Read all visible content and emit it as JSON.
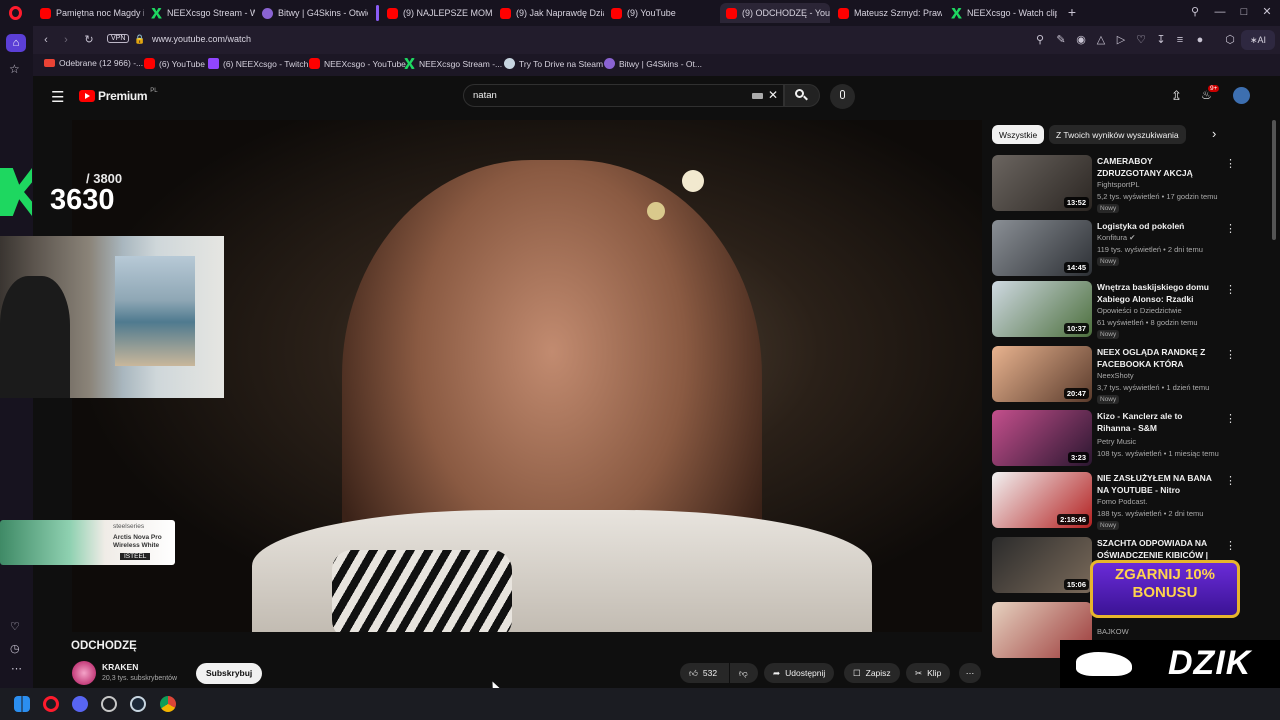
{
  "tabs": [
    {
      "label": "Pamiętna noc Magdy i St",
      "icon": "youtube-icon"
    },
    {
      "label": "NEEXcsgo Stream - Watch",
      "icon": "neex-icon"
    },
    {
      "label": "Bitwy | G4Skins - Otwieraj",
      "icon": "g4skins-icon"
    },
    {
      "label": "(9) NAJLEPSZE MOMENTY",
      "icon": "youtube-icon"
    },
    {
      "label": "(9) Jak Naprawdę Działa F",
      "icon": "youtube-icon"
    },
    {
      "label": "(9) YouTube",
      "icon": "youtube-icon"
    },
    {
      "label": "(9) ODCHODZĘ - You",
      "icon": "youtube-icon"
    },
    {
      "label": "Mateusz Szmyd: Prawie zg",
      "icon": "youtube-icon"
    },
    {
      "label": "NEEXcsgo - Watch clips o",
      "icon": "neex-icon"
    }
  ],
  "address": {
    "vpn": "VPN",
    "url": "www.youtube.com/watch",
    "ai": "AI"
  },
  "bookmarks": [
    {
      "label": "Odebrane (12 966) -..."
    },
    {
      "label": "(6) YouTube"
    },
    {
      "label": "(6) NEEXcsgo - Twitch"
    },
    {
      "label": "NEEXcsgo - YouTube"
    },
    {
      "label": "NEEXcsgo Stream -..."
    },
    {
      "label": "Try To Drive na Steam"
    },
    {
      "label": "Bitwy | G4Skins - Ot..."
    }
  ],
  "yt": {
    "logo": "Premium",
    "region": "PL",
    "search_value": "natan",
    "notif_count": "9+"
  },
  "chips": [
    "Wszystkie",
    "Z Twoich wyników wyszukiwania"
  ],
  "overlay": {
    "counter_goal": "/ 3800",
    "counter_value": "3630",
    "ad_brand": "steelseries",
    "ad_product": "Arctis Nova Pro Wireless White",
    "ad_code": "ISTEEL"
  },
  "video": {
    "title": "ODCHODZĘ",
    "channel": "KRAKEN",
    "subscribers": "20,3 tys. subskrybentów",
    "subscribe": "Subskrybuj",
    "likes": "532",
    "share": "Udostępnij",
    "save": "Zapisz",
    "clip": "Klip"
  },
  "recommendations": [
    {
      "title": "CAMERABOY ZDRUZGOTANY AKCJĄ BOMBY I NIKITY! NIE ...",
      "channel": "FightsportPL",
      "meta": "5,2 tys. wyświetleń • 17 godzin temu",
      "badge": "Nowy",
      "duration": "13:52"
    },
    {
      "title": "Logistyka od pokoleń",
      "channel": "Konfitura",
      "meta": "119 tys. wyświetleń • 2 dni temu",
      "badge": "Nowy",
      "duration": "14:45"
    },
    {
      "title": "Wnętrza baskijskiego domu Xabiego Alonso: Rzadki widok",
      "channel": "Opowieści o Dziedzictwie",
      "meta": "61 wyświetleń • 8 godzin temu",
      "badge": "Nowy",
      "duration": "10:37"
    },
    {
      "title": "NEEX OGLĄDA RANDKĘ Z FACEBOOKA KTÓRA OKAZAŁ...",
      "channel": "NeexShoty",
      "meta": "3,7 tys. wyświetleń • 1 dzień temu",
      "badge": "Nowy",
      "duration": "20:47"
    },
    {
      "title": "Kizo - Kanclerz ale to Rihanna - S&M",
      "channel": "Petry Music",
      "meta": "108 tys. wyświetleń • 1 miesiąc temu",
      "badge": "",
      "duration": "3:23"
    },
    {
      "title": "NIE ZASŁUŻYŁEM NA BANA NA YOUTUBE - Nitro",
      "channel": "Fomo Podcast.",
      "meta": "188 tys. wyświetleń • 2 dni temu",
      "badge": "Nowy",
      "duration": "2:18:46"
    },
    {
      "title": "SZACHTA ODPOWIADA NA OŚWIADCZENIE KIBICÓW | CZ",
      "channel": "",
      "meta": "",
      "badge": "",
      "duration": "15:06"
    },
    {
      "title": "",
      "channel": "BAJKOW",
      "meta": "",
      "badge": "",
      "duration": ""
    }
  ],
  "sponsor": {
    "promo": "ZGARNIJ 10% BONUSU",
    "brand": "DZIK"
  }
}
